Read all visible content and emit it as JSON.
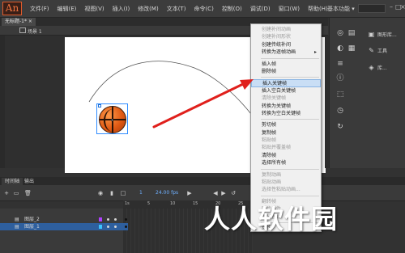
{
  "app": {
    "logo_text": "An"
  },
  "menubar": {
    "items": [
      "文件(F)",
      "编辑(E)",
      "视图(V)",
      "插入(I)",
      "修改(M)",
      "文本(T)",
      "命令(C)",
      "控制(O)",
      "调试(D)",
      "窗口(W)",
      "帮助(H)"
    ]
  },
  "workspace": {
    "label": "基本功能 ▾"
  },
  "document": {
    "tab_label": "无标题-1* ×"
  },
  "scene": {
    "label": "场景 1"
  },
  "right_panels": {
    "items": [
      {
        "icon": "image-icon",
        "label": "图形库..."
      },
      {
        "icon": "tools-icon",
        "label": "工具"
      },
      {
        "icon": "component-icon",
        "label": "库..."
      }
    ]
  },
  "context_menu": {
    "sections": [
      [
        {
          "label": "创建补间动画",
          "disabled": true
        },
        {
          "label": "创建补间形状",
          "disabled": true
        },
        {
          "label": "创建传统补间",
          "disabled": false
        },
        {
          "label": "转换为逐帧动画",
          "disabled": false,
          "submenu": true
        }
      ],
      [
        {
          "label": "插入帧",
          "disabled": false
        },
        {
          "label": "删除帧",
          "disabled": false
        }
      ],
      [
        {
          "label": "插入关键帧",
          "disabled": false,
          "highlight": true
        },
        {
          "label": "插入空白关键帧",
          "disabled": false
        },
        {
          "label": "清除关键帧",
          "disabled": true
        },
        {
          "label": "转换为关键帧",
          "disabled": false
        },
        {
          "label": "转换为空白关键帧",
          "disabled": false
        }
      ],
      [
        {
          "label": "剪切帧",
          "disabled": false
        },
        {
          "label": "复制帧",
          "disabled": false
        },
        {
          "label": "粘贴帧",
          "disabled": true
        },
        {
          "label": "粘贴并覆盖帧",
          "disabled": true
        },
        {
          "label": "清除帧",
          "disabled": false
        },
        {
          "label": "选择所有帧",
          "disabled": false
        }
      ],
      [
        {
          "label": "复制动画",
          "disabled": true
        },
        {
          "label": "粘贴动画",
          "disabled": true
        },
        {
          "label": "选择性粘贴动画...",
          "disabled": true
        }
      ],
      [
        {
          "label": "翻转帧",
          "disabled": true
        },
        {
          "label": "同步元件",
          "disabled": true
        },
        {
          "label": "拆分音频",
          "disabled": true
        }
      ],
      [
        {
          "label": "动作",
          "disabled": false
        }
      ]
    ]
  },
  "timeline": {
    "tabs": [
      "时间轴",
      "输出"
    ],
    "frame_field": "1",
    "fps_field": "24.00 fps",
    "ruler_numbers": [
      "1s",
      "5",
      "10",
      "15",
      "20",
      "25"
    ],
    "layers": [
      {
        "name": "图层_2",
        "selected": false,
        "swatch": "#b040ff"
      },
      {
        "name": "图层_1",
        "selected": true,
        "swatch": "#3cc4ff"
      }
    ]
  },
  "watermark": {
    "text": "人人软件园"
  },
  "colors": {
    "accent": "#2e5f9e",
    "arrow": "#e0201c",
    "highlight": "#c9def5"
  }
}
